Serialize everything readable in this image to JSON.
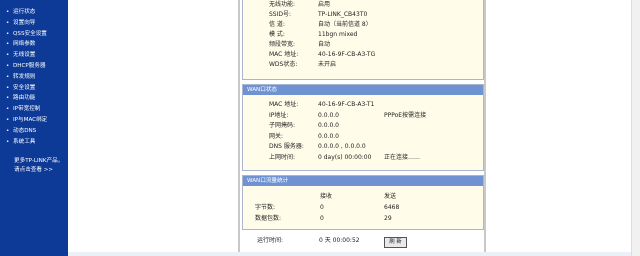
{
  "sidebar": {
    "items": [
      {
        "label": "运行状态"
      },
      {
        "label": "设置向导"
      },
      {
        "label": "QSS安全设置"
      },
      {
        "label": "网络参数"
      },
      {
        "label": "无线设置"
      },
      {
        "label": "DHCP服务器"
      },
      {
        "label": "转发规则"
      },
      {
        "label": "安全设置"
      },
      {
        "label": "路由功能"
      },
      {
        "label": "IP带宽控制"
      },
      {
        "label": "IP与MAC绑定"
      },
      {
        "label": "动态DNS"
      },
      {
        "label": "系统工具"
      }
    ],
    "promo_line1": "更多TP-LINK产品，",
    "promo_line2": "请点击查看 >>"
  },
  "wireless": {
    "rows": [
      {
        "label": "无线功能:",
        "value": "启用"
      },
      {
        "label": "SSID号:",
        "value": "TP-LINK_CB43T0"
      },
      {
        "label": "信 道:",
        "value": "自动（当前信道 8）"
      },
      {
        "label": "模 式:",
        "value": "11bgn mixed"
      },
      {
        "label": "频段带宽:",
        "value": "自动"
      },
      {
        "label": "MAC 地址:",
        "value": "40-16-9F-CB-A3-TG"
      },
      {
        "label": "WDS状态:",
        "value": "未开启"
      }
    ]
  },
  "wan": {
    "title": "WAN口状态",
    "rows": [
      {
        "label": "MAC 地址:",
        "value": "40-16-9F-CB-A3-T1",
        "extra": ""
      },
      {
        "label": "IP地址:",
        "value": "0.0.0.0",
        "extra": "PPPoE按需连接"
      },
      {
        "label": "子网掩码:",
        "value": "0.0.0.0",
        "extra": ""
      },
      {
        "label": "网关:",
        "value": "0.0.0.0",
        "extra": ""
      },
      {
        "label": "DNS 服务器:",
        "value": "0.0.0.0 , 0.0.0.0",
        "extra": ""
      },
      {
        "label": "上网时间:",
        "value": "0 day(s) 00:00:00",
        "extra": "正在连接……"
      }
    ]
  },
  "traffic": {
    "title": "WAN口流量统计",
    "col_recv": "接收",
    "col_send": "发送",
    "rows": [
      {
        "label": "字节数:",
        "recv": "0",
        "send": "6468"
      },
      {
        "label": "数据包数:",
        "recv": "0",
        "send": "29"
      }
    ]
  },
  "runtime": {
    "label": "运行时间:",
    "value": "0 天 00:00:52",
    "refresh_label": "刷 新"
  }
}
